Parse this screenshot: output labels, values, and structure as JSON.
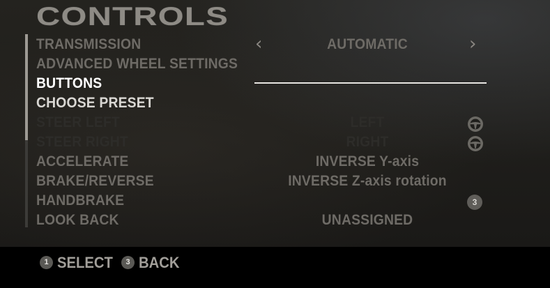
{
  "screen": {
    "title": "CONTROLS"
  },
  "rows": [
    {
      "label": "TRANSMISSION",
      "value": "AUTOMATIC"
    },
    {
      "label": "ADVANCED WHEEL SETTINGS",
      "value": ""
    },
    {
      "label": "BUTTONS",
      "value": ""
    },
    {
      "label": "CHOOSE PRESET",
      "value": ""
    },
    {
      "label": "STEER LEFT",
      "value": "LEFT",
      "icon": "steering-wheel-icon"
    },
    {
      "label": "STEER RIGHT",
      "value": "RIGHT",
      "icon": "steering-wheel-icon"
    },
    {
      "label": "ACCELERATE",
      "value": "INVERSE Y-axis"
    },
    {
      "label": "BRAKE/REVERSE",
      "value": "INVERSE Z-axis rotation"
    },
    {
      "label": "HANDBRAKE",
      "value": "",
      "badge": "3"
    },
    {
      "label": "LOOK BACK",
      "value": "UNASSIGNED"
    }
  ],
  "transmission_arrows": {
    "left": "‹",
    "right": "›"
  },
  "footer": {
    "select_badge": "1",
    "select_label": "SELECT",
    "back_badge": "3",
    "back_label": "BACK"
  },
  "colors": {
    "selected": "#ffffff",
    "normal": "#6e6b66",
    "disabled": "#2d2c29",
    "footer_bg": "#000000"
  }
}
